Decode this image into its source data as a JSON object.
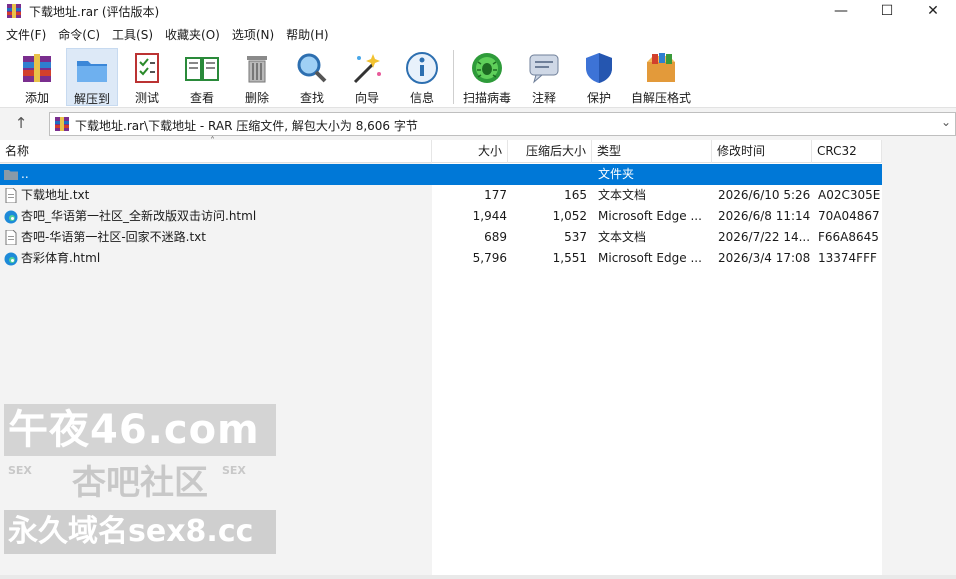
{
  "window": {
    "title": "下载地址.rar (评估版本)",
    "minimize_icon": "minimize-icon",
    "maximize_icon": "maximize-icon",
    "close_icon": "close-icon"
  },
  "menu": [
    "文件(F)",
    "命令(C)",
    "工具(S)",
    "收藏夹(O)",
    "选项(N)",
    "帮助(H)"
  ],
  "toolbar": [
    {
      "label": "添加",
      "icon": "add-archive-icon"
    },
    {
      "label": "解压到",
      "icon": "extract-folder-icon"
    },
    {
      "label": "测试",
      "icon": "test-checklist-icon"
    },
    {
      "label": "查看",
      "icon": "view-book-icon"
    },
    {
      "label": "删除",
      "icon": "trash-icon"
    },
    {
      "label": "查找",
      "icon": "magnifier-icon"
    },
    {
      "label": "向导",
      "icon": "wizard-wand-icon"
    },
    {
      "label": "信息",
      "icon": "info-icon"
    },
    {
      "label": "扫描病毒",
      "icon": "virus-scan-icon"
    },
    {
      "label": "注释",
      "icon": "comment-icon"
    },
    {
      "label": "保护",
      "icon": "shield-icon"
    },
    {
      "label": "自解压格式",
      "icon": "sfx-box-icon"
    }
  ],
  "address": {
    "text": "下载地址.rar\\下载地址 - RAR 压缩文件, 解包大小为 8,606 字节"
  },
  "columns": {
    "name": "名称",
    "size": "大小",
    "packed": "压缩后大小",
    "type": "类型",
    "modified": "修改时间",
    "crc": "CRC32"
  },
  "rows": [
    {
      "name": "..",
      "size": "",
      "packed": "",
      "type": "文件夹",
      "modified": "",
      "crc": "",
      "icon": "folder-icon"
    },
    {
      "name": "下载地址.txt",
      "size": "177",
      "packed": "165",
      "type": "文本文档",
      "modified": "2026/6/10 5:26",
      "crc": "A02C305E",
      "icon": "text-file-icon"
    },
    {
      "name": "杏吧_华语第一社区_全新改版双击访问.html",
      "size": "1,944",
      "packed": "1,052",
      "type": "Microsoft Edge ...",
      "modified": "2026/6/8 11:14",
      "crc": "70A04867",
      "icon": "edge-html-icon"
    },
    {
      "name": "杏吧-华语第一社区-回家不迷路.txt",
      "size": "689",
      "packed": "537",
      "type": "文本文档",
      "modified": "2026/7/22 14...",
      "crc": "F66A8645",
      "icon": "text-file-icon"
    },
    {
      "name": "杏彩体育.html",
      "size": "5,796",
      "packed": "1,551",
      "type": "Microsoft Edge ...",
      "modified": "2026/3/4 17:08",
      "crc": "13374FFF",
      "icon": "edge-html-icon"
    }
  ],
  "watermark": {
    "line1": "午夜46.com",
    "line2": "杏吧社区",
    "line3": "永久域名sex8.cc",
    "sex_left": "SEX",
    "sex_right": "SEX"
  },
  "colors": {
    "selection": "#0078d7"
  }
}
